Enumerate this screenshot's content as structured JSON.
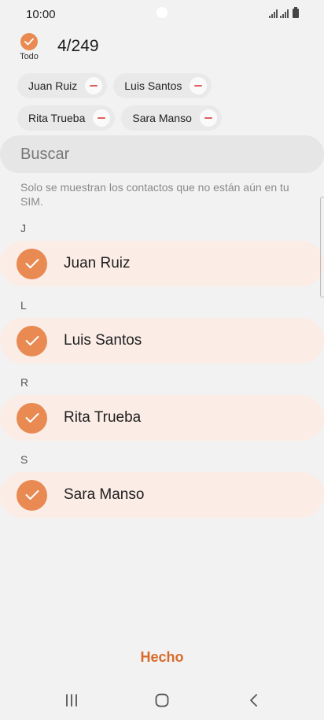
{
  "status_bar": {
    "time": "10:00"
  },
  "header": {
    "select_all_label": "Todo",
    "count": "4/249"
  },
  "selected_chips": [
    {
      "label": "Juan Ruiz"
    },
    {
      "label": "Luis Santos"
    },
    {
      "label": "Rita Trueba"
    },
    {
      "label": "Sara Manso"
    }
  ],
  "search": {
    "placeholder": "Buscar"
  },
  "info_text": "Solo se muestran los contactos que no están aún en tu SIM.",
  "sections": [
    {
      "letter": "J",
      "contacts": [
        {
          "name": "Juan Ruiz",
          "checked": true
        }
      ]
    },
    {
      "letter": "L",
      "contacts": [
        {
          "name": "Luis Santos",
          "checked": true
        }
      ]
    },
    {
      "letter": "R",
      "contacts": [
        {
          "name": "Rita Trueba",
          "checked": true
        }
      ]
    },
    {
      "letter": "S",
      "contacts": [
        {
          "name": "Sara Manso",
          "checked": true
        }
      ]
    }
  ],
  "footer": {
    "done_label": "Hecho"
  },
  "colors": {
    "accent": "#e88a52",
    "done_text": "#d8692a",
    "row_bg": "#fbece6"
  },
  "icons": {
    "check": "check-icon",
    "remove": "minus-icon",
    "nav_recent": "recent-apps-icon",
    "nav_home": "home-icon",
    "nav_back": "back-icon"
  }
}
